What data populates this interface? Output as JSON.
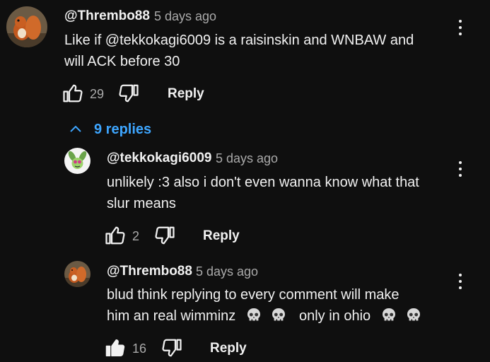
{
  "comments": [
    {
      "author": "@Thrembo88",
      "time": "5 days ago",
      "text_line1": "Like if @tekkokagi6009 is a raisinskin and WNBAW and",
      "text_line2": "will ACK before 30",
      "likes": "29",
      "reply_label": "Reply",
      "avatar_icon": "squirrel-avatar",
      "liked": false
    },
    {
      "author": "@tekkokagi6009",
      "time": "5 days ago",
      "text_line1": "unlikely :3 also i don't even wanna know what that",
      "text_line2": "slur means",
      "likes": "2",
      "reply_label": "Reply",
      "avatar_icon": "cartoon-creature-avatar",
      "liked": false
    },
    {
      "author": "@Thrembo88",
      "time": "5 days ago",
      "text_line2_a": "him an real wimminz",
      "text_line1": "blud think replying to every comment will make",
      "text_line2_b": "only in ohio",
      "likes": "16",
      "reply_label": "Reply",
      "avatar_icon": "squirrel-avatar",
      "liked": true,
      "emoji": "skull-emoji"
    }
  ],
  "replies_toggle": {
    "label": "9 replies",
    "icon": "chevron-up-icon"
  },
  "colors": {
    "background": "#0f0f0f",
    "text": "#f1f1f1",
    "secondary": "#aaaaaa",
    "link": "#3ea6ff"
  }
}
